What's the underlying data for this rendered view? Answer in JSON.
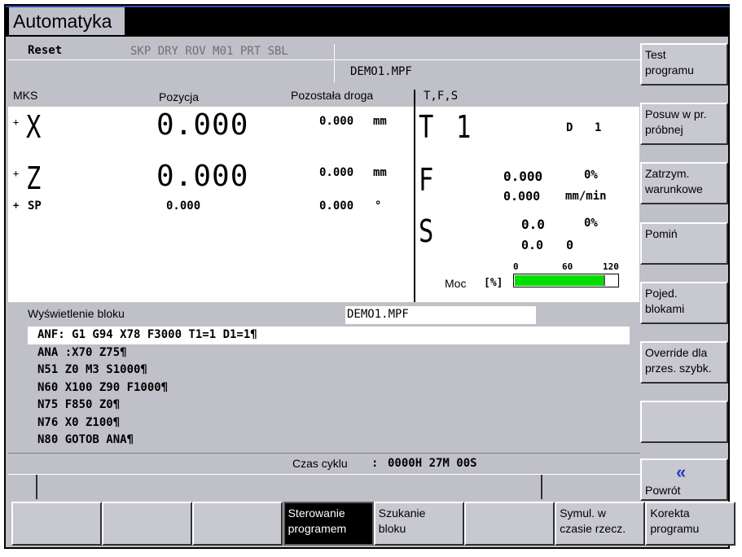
{
  "title": "Automatyka",
  "status": {
    "reset": "Reset",
    "modes": "SKP DRY ROV M01 PRT SBL"
  },
  "program_file": "DEMO1.MPF",
  "headers": {
    "mks": "MKS",
    "pozycja": "Pozycja",
    "pozostala": "Pozostała droga",
    "tfs": "T,F,S"
  },
  "axes": [
    {
      "name": "X",
      "position": "0.000",
      "remaining": "0.000",
      "unit": "mm"
    },
    {
      "name": "Z",
      "position": "0.000",
      "remaining": "0.000",
      "unit": "mm"
    }
  ],
  "spindle": {
    "name": "SP",
    "position": "0.000",
    "remaining": "0.000",
    "unit": "°"
  },
  "tool": {
    "label": "T",
    "number": "1",
    "d_label": "D",
    "d_number": "1"
  },
  "feed": {
    "label": "F",
    "value": "0.000",
    "override": "0%",
    "value2": "0.000",
    "unit": "mm/min"
  },
  "speed": {
    "label": "S",
    "value": "0.0",
    "override": "0%",
    "value2": "0.0",
    "value3": "0"
  },
  "power": {
    "label": "Moc",
    "unit": "[%]",
    "scale": [
      "0",
      "60",
      "120"
    ],
    "level_percent": 88
  },
  "block_display": {
    "label": "Wyświetlenie bloku",
    "file": "DEMO1.MPF",
    "lines": [
      "ANF: G1 G94 X78 F3000 T1=1 D1=1¶",
      "ANA :X70 Z75¶",
      "N51 Z0 M3 S1000¶",
      "N60 X100 Z90 F1000¶",
      "N75 F850 Z0¶",
      "N76 X0 Z100¶",
      "N80 GOTOB ANA¶"
    ]
  },
  "cycle": {
    "label": "Czas cyklu",
    "separator": ":",
    "value": "0000H 27M 00S"
  },
  "softkeys_right": [
    "Test\nprogramu",
    "Posuw w pr.\npróbnej",
    "Zatrzym.\nwarunkowe",
    "Pomiń",
    "Pojed.\nblokami",
    "Override dla\nprzes. szybk.",
    "",
    "Powrót"
  ],
  "back_glyph": "«",
  "softkeys_bottom": [
    "",
    "",
    "",
    "Sterowanie\nprogramem",
    "Szukanie\nbloku",
    "",
    "Symul. w\nczasie rzecz.",
    "Korekta\nprogramu"
  ],
  "colors": {
    "power_bar": "#00e000",
    "title_accent": "#3050b0"
  }
}
